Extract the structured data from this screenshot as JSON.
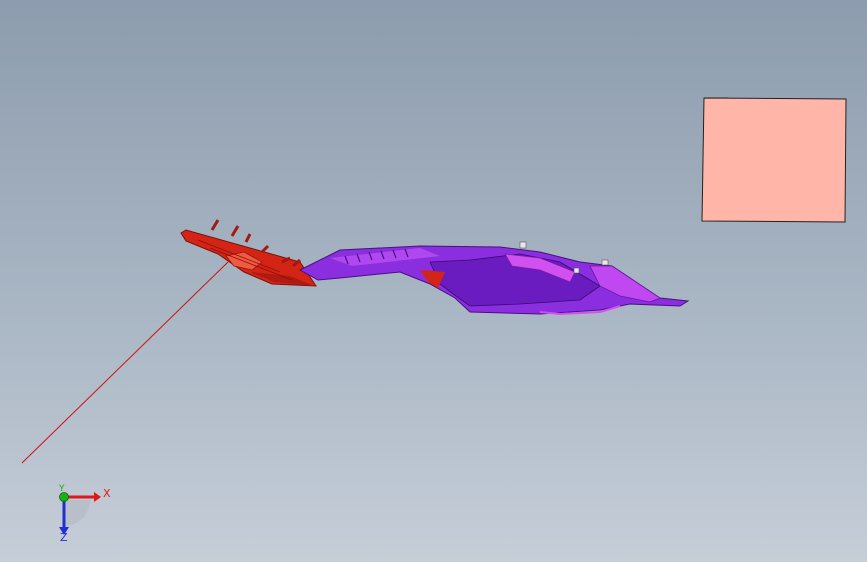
{
  "triad": {
    "x_label": "X",
    "y_label": "Y",
    "z_label": "Z",
    "x_color": "#e01818",
    "y_color": "#18b018",
    "z_color": "#2030d0"
  },
  "colors": {
    "red_part": "#d42416",
    "purple_part": "#8a2ee0",
    "magenta_highlight": "#d050f0",
    "sketch_plane": "#ffb6a8",
    "sketch_line": "#d01010"
  }
}
